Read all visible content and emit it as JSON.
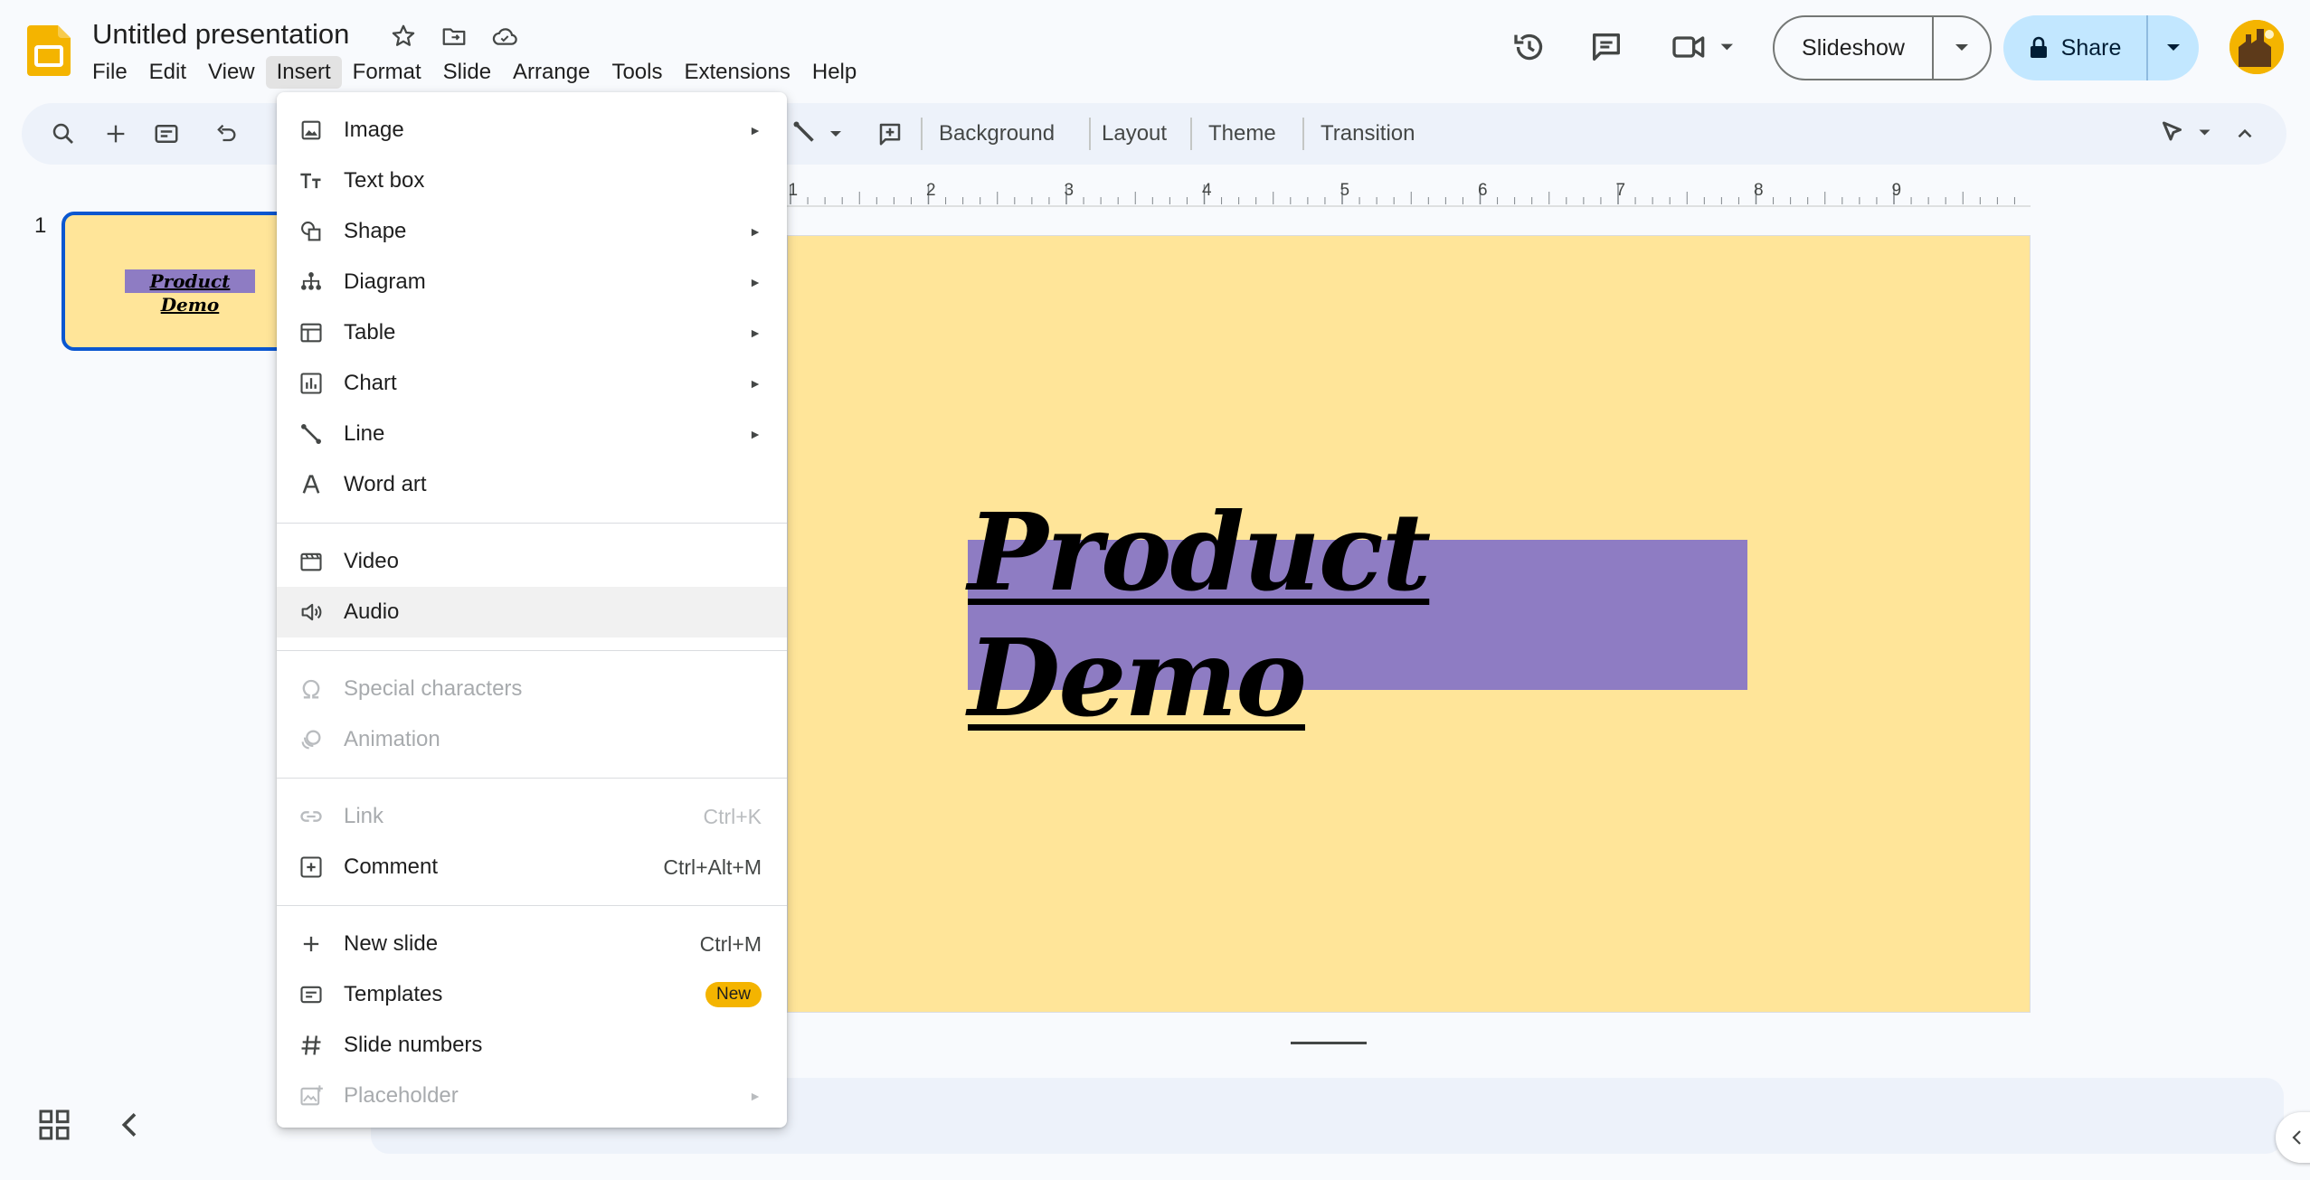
{
  "header": {
    "title": "Untitled presentation",
    "menus": [
      "File",
      "Edit",
      "View",
      "Insert",
      "Format",
      "Slide",
      "Arrange",
      "Tools",
      "Extensions",
      "Help"
    ],
    "active_menu": "Insert",
    "slideshow_label": "Slideshow",
    "share_label": "Share"
  },
  "toolbar": {
    "background_label": "Background",
    "layout_label": "Layout",
    "theme_label": "Theme",
    "transition_label": "Transition"
  },
  "ruler": [
    "1",
    "2",
    "3",
    "4",
    "5",
    "6",
    "7",
    "8",
    "9"
  ],
  "filmstrip": {
    "slide_number": "1",
    "thumb_title": "Product Demo"
  },
  "slide": {
    "title": "Product Demo",
    "background_color": "#ffe599",
    "title_box_color": "#8e7cc3"
  },
  "insert_menu": {
    "items": [
      {
        "label": "Image",
        "icon": "image-icon",
        "submenu": true
      },
      {
        "label": "Text box",
        "icon": "text-box-icon"
      },
      {
        "label": "Shape",
        "icon": "shape-icon",
        "submenu": true
      },
      {
        "label": "Diagram",
        "icon": "diagram-icon",
        "submenu": true
      },
      {
        "label": "Table",
        "icon": "table-icon",
        "submenu": true
      },
      {
        "label": "Chart",
        "icon": "chart-icon",
        "submenu": true
      },
      {
        "label": "Line",
        "icon": "line-icon",
        "submenu": true
      },
      {
        "label": "Word art",
        "icon": "word-art-icon"
      },
      {
        "label": "Video",
        "icon": "video-icon"
      },
      {
        "label": "Audio",
        "icon": "audio-icon",
        "hover": true
      },
      {
        "label": "Special characters",
        "icon": "omega-icon",
        "disabled": true
      },
      {
        "label": "Animation",
        "icon": "animation-icon",
        "disabled": true
      },
      {
        "label": "Link",
        "icon": "link-icon",
        "disabled": true,
        "shortcut": "Ctrl+K"
      },
      {
        "label": "Comment",
        "icon": "comment-add-icon",
        "shortcut": "Ctrl+Alt+M"
      },
      {
        "label": "New slide",
        "icon": "plus-icon",
        "shortcut": "Ctrl+M"
      },
      {
        "label": "Templates",
        "icon": "templates-icon",
        "badge": "New"
      },
      {
        "label": "Slide numbers",
        "icon": "hash-icon"
      },
      {
        "label": "Placeholder",
        "icon": "placeholder-icon",
        "disabled": true,
        "submenu": true
      }
    ],
    "arrow_glyph": "►"
  }
}
